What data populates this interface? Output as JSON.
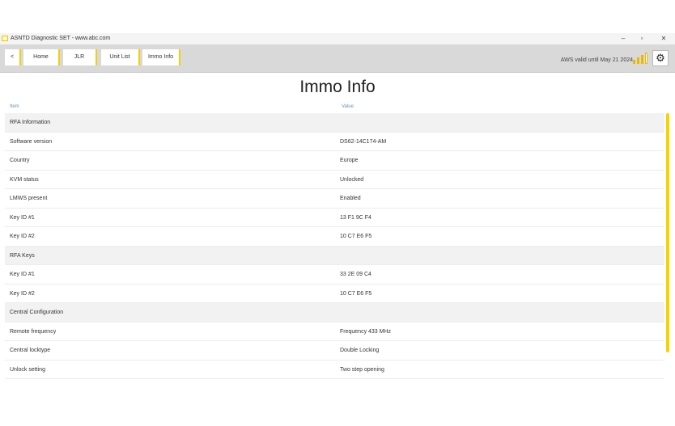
{
  "window": {
    "title": "ASNTD Diagnostic SET - www.abc.com",
    "controls": [
      "–",
      "▫",
      "✕"
    ]
  },
  "toolbar": {
    "back_label": "<",
    "home_label": "Home",
    "tab2_label": "JLR",
    "tab3_label": "Unit List",
    "tab4_label": "Immo Info",
    "status_text": "AWS valid until May 21 2024",
    "accent_color": "#f4d000"
  },
  "page": {
    "title": "Immo Info",
    "col_item": "Item",
    "col_value": "Value"
  },
  "rows": [
    {
      "type": "section",
      "key": "RFA Information",
      "value": ""
    },
    {
      "type": "item",
      "key": "Software version",
      "value": "DS62-14C174-AM"
    },
    {
      "type": "item",
      "key": "Country",
      "value": "Europe"
    },
    {
      "type": "item",
      "key": "KVM status",
      "value": "Unlocked"
    },
    {
      "type": "item",
      "key": "LMWS present",
      "value": "Enabled"
    },
    {
      "type": "item",
      "key": "Key ID #1",
      "value": "13 F1 9C F4"
    },
    {
      "type": "item",
      "key": "Key ID #2",
      "value": "10 C7 E6 F5"
    },
    {
      "type": "section",
      "key": "RFA Keys",
      "value": ""
    },
    {
      "type": "item",
      "key": "Key ID #1",
      "value": "33 2E 09 C4"
    },
    {
      "type": "item",
      "key": "Key ID #2",
      "value": "10 C7 E6 F5"
    },
    {
      "type": "section",
      "key": "Central Configuration",
      "value": ""
    },
    {
      "type": "item",
      "key": "Remote frequency",
      "value": "Frequency 433 MHz"
    },
    {
      "type": "item",
      "key": "Central locktype",
      "value": "Double Locking"
    },
    {
      "type": "item",
      "key": "Unlock setting",
      "value": "Two step opening"
    }
  ]
}
